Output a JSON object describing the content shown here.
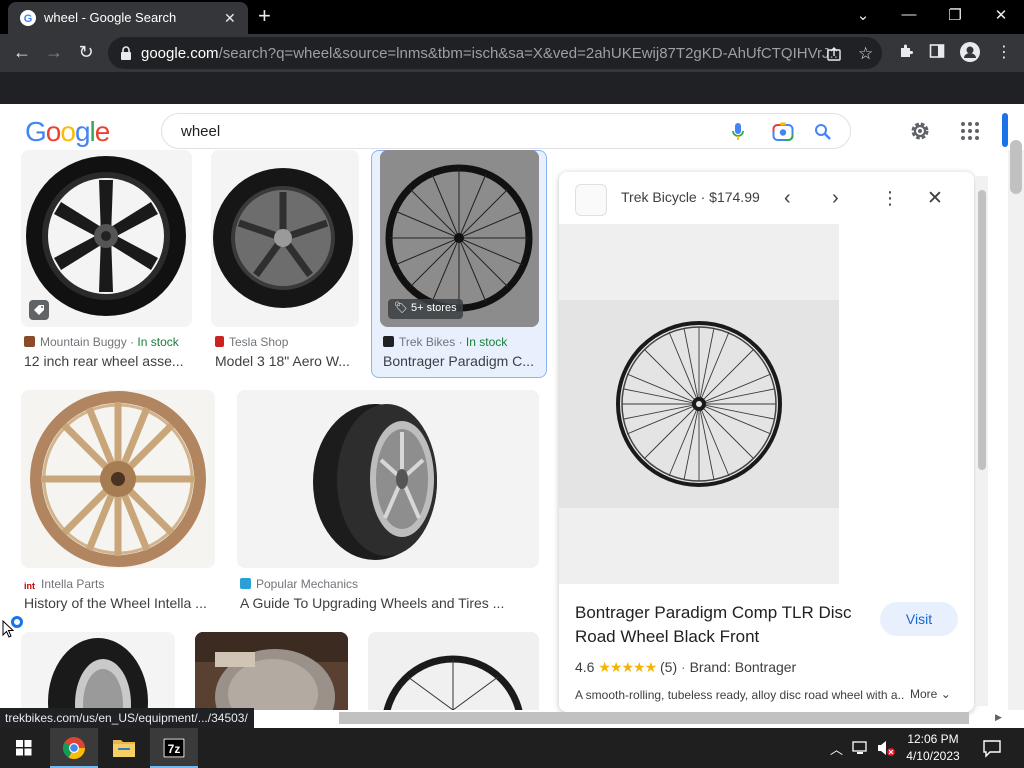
{
  "browser": {
    "tab_title": "wheel - Google Search",
    "url_host": "google.com",
    "url_rest": "/search?q=wheel&source=lnms&tbm=isch&sa=X&ved=2ahUKEwij87T2gKD-AhUfCTQIHVrJ...",
    "status_url": "trekbikes.com/us/en_US/equipment/.../34503/"
  },
  "google": {
    "logo_letters": [
      "G",
      "o",
      "o",
      "g",
      "l",
      "e"
    ],
    "logo_colors": [
      "#4285F4",
      "#EA4335",
      "#FBBC05",
      "#4285F4",
      "#34A853",
      "#EA4335"
    ],
    "search_query": "wheel"
  },
  "results": [
    {
      "source": "Mountain Buggy",
      "stock": "In stock",
      "caption": "12 inch rear wheel asse..."
    },
    {
      "source": "Tesla Shop",
      "stock": "",
      "caption": "Model 3 18\" Aero W..."
    },
    {
      "source": "Trek Bikes",
      "stock": "In stock",
      "caption": "Bontrager Paradigm C...",
      "badge": "5+ stores"
    },
    {
      "source": "Intella Parts",
      "stock": "",
      "caption": "History of the Wheel Intella ..."
    },
    {
      "source": "Popular Mechanics",
      "stock": "",
      "caption": "A Guide To Upgrading Wheels and Tires ..."
    }
  ],
  "panel": {
    "header": "Trek Bicycle · $174.99",
    "title_line1": "Bontrager Paradigm Comp TLR Disc",
    "title_line2": "Road Wheel Black Front",
    "rating": "4.6",
    "stars": "★★★★★",
    "review_count": "(5)",
    "brand": "Brand: Bontrager",
    "visit_label": "Visit",
    "description": "A smooth-rolling, tubeless ready, alloy disc road wheel with a...",
    "more_label": "More"
  },
  "taskbar": {
    "time": "12:06 PM",
    "date": "4/10/2023"
  }
}
